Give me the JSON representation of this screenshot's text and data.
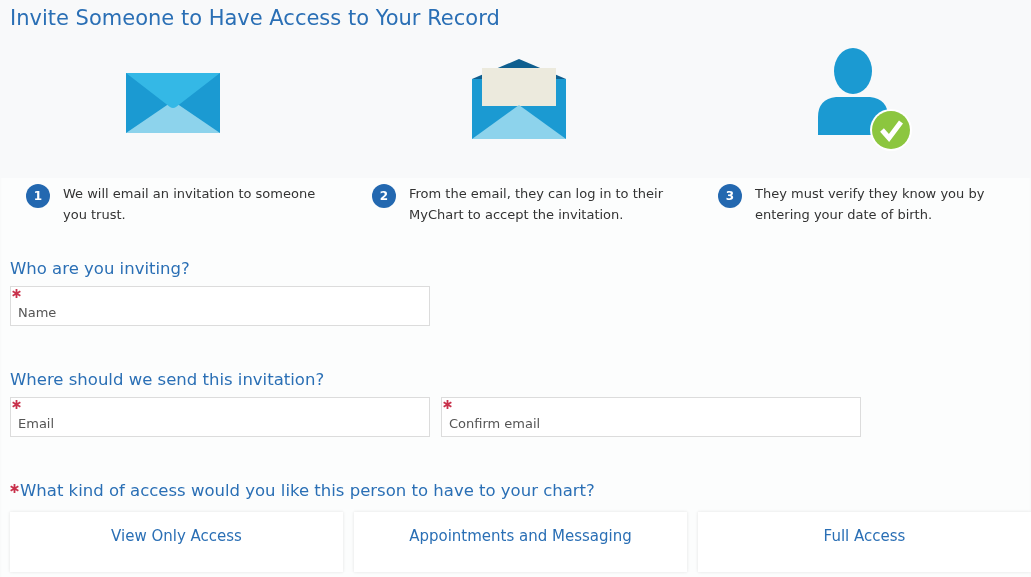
{
  "title": "Invite Someone to Have Access to Your Record",
  "steps": [
    {
      "kind": "envelope",
      "number": "1",
      "text": "We will email an invitation to someone you trust."
    },
    {
      "kind": "open-envelope",
      "number": "2",
      "text": "From the email, they can log in to their MyChart to accept the invitation."
    },
    {
      "kind": "person-check",
      "number": "3",
      "text": "They must verify they know you by entering your date of birth."
    }
  ],
  "sections": [
    {
      "heading": "Who are you inviting?",
      "fields": [
        {
          "placeholder": "Name",
          "required": true
        }
      ]
    },
    {
      "heading": "Where should we send this invitation?",
      "fields": [
        {
          "placeholder": "Email",
          "required": true
        },
        {
          "placeholder": "Confirm email",
          "required": true
        }
      ]
    }
  ],
  "access": {
    "question": "What kind of access would you like this person to have to your chart?",
    "required": true,
    "options": [
      {
        "label": "View Only Access",
        "selected": false
      },
      {
        "label": "Appointments and Messaging",
        "selected": false
      },
      {
        "label": "Full Access",
        "selected": false
      }
    ]
  }
}
